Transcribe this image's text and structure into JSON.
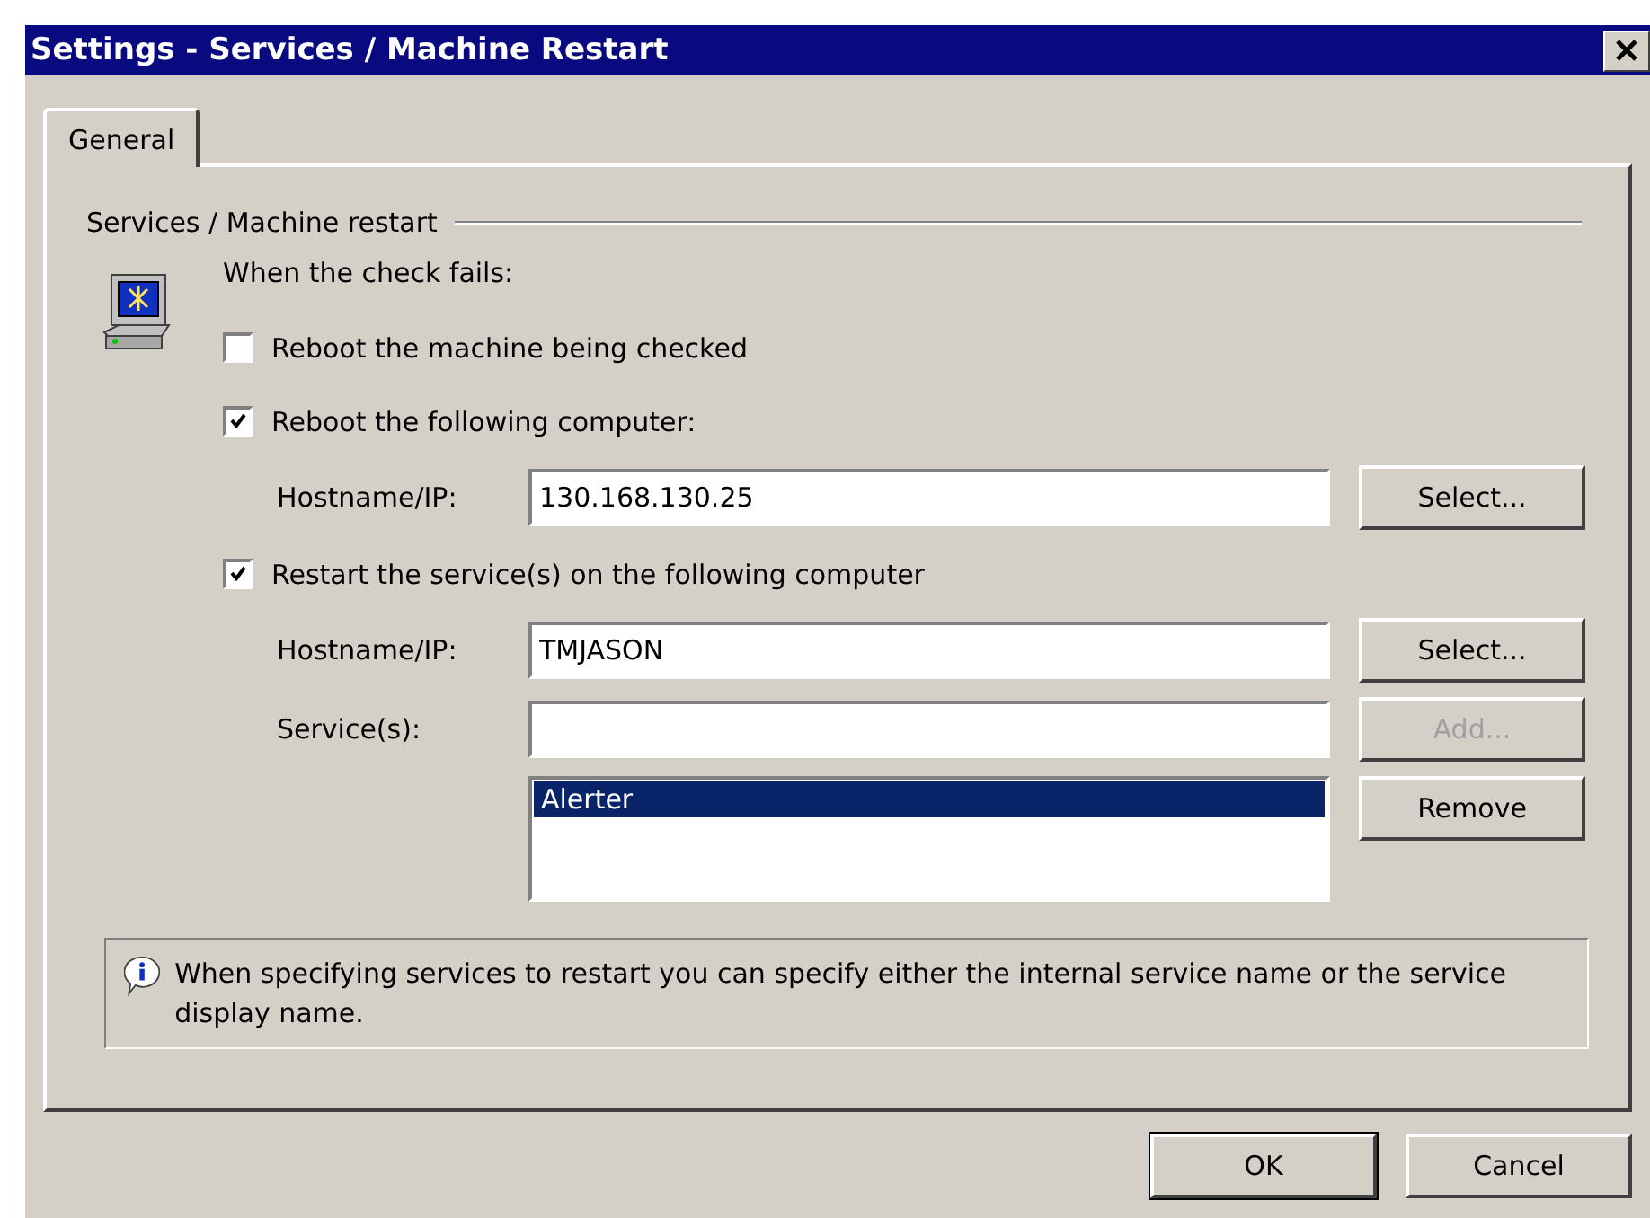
{
  "window": {
    "title": "Settings - Services / Machine Restart"
  },
  "tabs": [
    {
      "label": "General",
      "selected": true
    }
  ],
  "group": {
    "title": "Services / Machine restart",
    "prompt": "When the check fails:"
  },
  "options": [
    {
      "kind": "checkbox",
      "label": "Reboot the machine being checked",
      "checked": false
    },
    {
      "kind": "checkbox",
      "label": "Reboot the following computer:",
      "checked": true
    },
    {
      "kind": "field",
      "label": "Hostname/IP:",
      "value": "130.168.130.25",
      "button": {
        "label": "Select...",
        "disabled": false
      }
    },
    {
      "kind": "checkbox",
      "label": "Restart the service(s) on the following computer",
      "checked": true
    },
    {
      "kind": "field",
      "label": "Hostname/IP:",
      "value": "TMJASON",
      "button": {
        "label": "Select...",
        "disabled": false
      }
    },
    {
      "kind": "field",
      "label": "Service(s):",
      "button": {
        "label": "Add...",
        "disabled": true
      }
    },
    {
      "kind": "list",
      "items": [
        {
          "label": "Alerter",
          "selected": true
        }
      ],
      "button": {
        "label": "Remove",
        "disabled": false
      }
    }
  ],
  "info": "When specifying services to restart you can specify either the internal service name or the service display name.",
  "buttons": [
    {
      "label": "OK",
      "default": true
    },
    {
      "label": "Cancel",
      "default": false
    }
  ]
}
